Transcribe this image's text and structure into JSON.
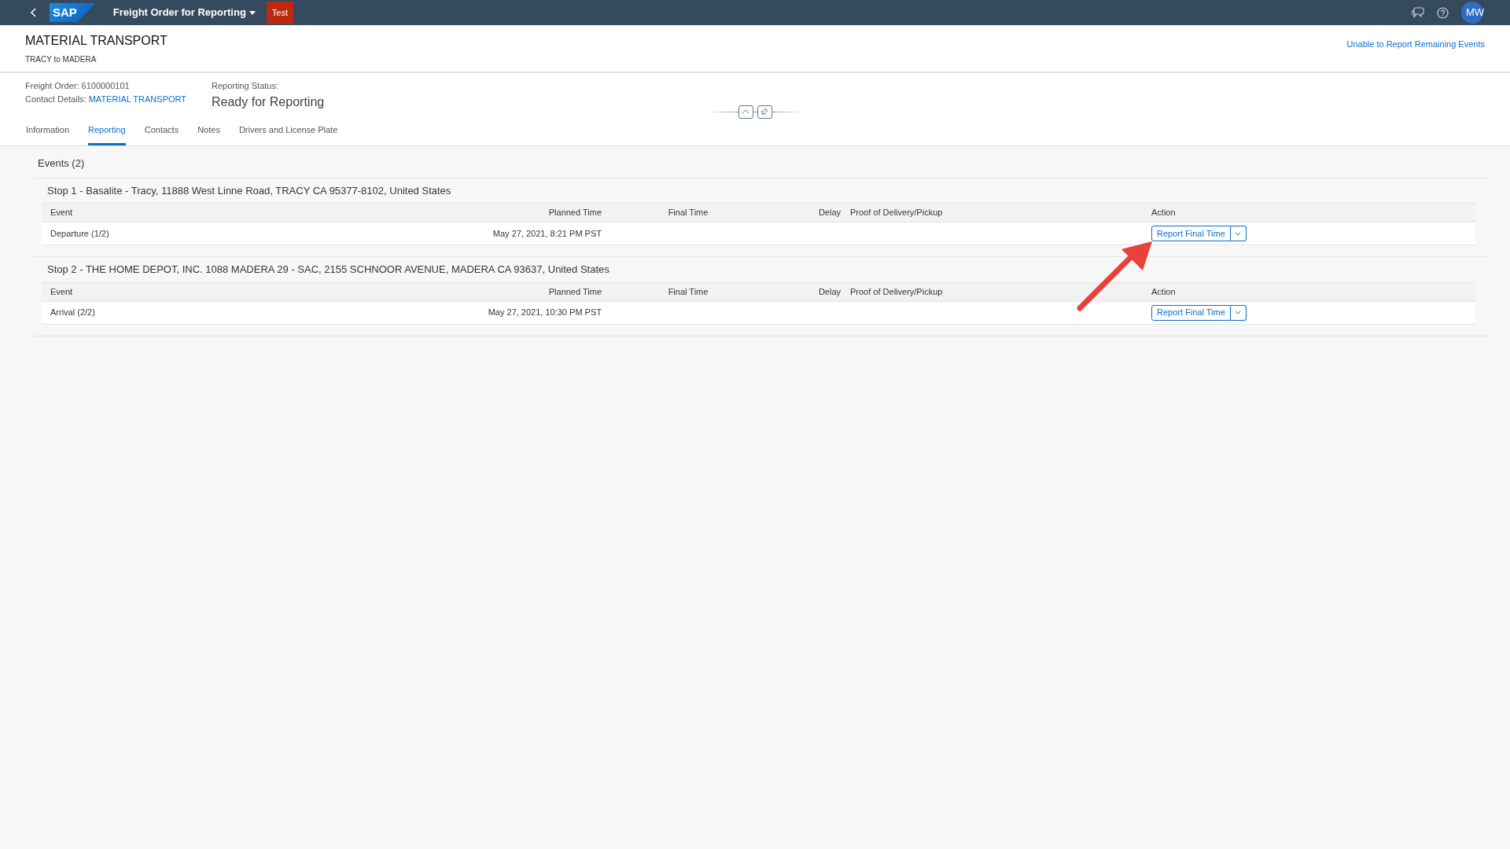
{
  "shell": {
    "logo": "SAP",
    "title": "Freight Order for Reporting",
    "badge": "Test",
    "avatar": "MW"
  },
  "header": {
    "title": "MATERIAL TRANSPORT",
    "subtitle": "TRACY to MADERA",
    "action_link": "Unable to Report Remaining Events",
    "fields": [
      {
        "label": "Freight Order:",
        "value": "6100000101",
        "kind": "text"
      },
      {
        "label": "Contact Details:",
        "value": "MATERIAL TRANSPORT",
        "kind": "link"
      }
    ],
    "status": {
      "label": "Reporting Status:",
      "value": "Ready for Reporting"
    }
  },
  "tabs": [
    {
      "label": "Information",
      "selected": false
    },
    {
      "label": "Reporting",
      "selected": true
    },
    {
      "label": "Contacts",
      "selected": false
    },
    {
      "label": "Notes",
      "selected": false
    },
    {
      "label": "Drivers and License Plate",
      "selected": false
    }
  ],
  "events": {
    "title": "Events (2)",
    "stops": [
      {
        "title": "Stop 1 - Basalite - Tracy, 11888 West Linne Road, TRACY CA 95377-8102, United States",
        "columns": [
          "Event",
          "Planned Time",
          "Final Time",
          "Delay",
          "Proof of Delivery/Pickup",
          "Action"
        ],
        "rows": [
          {
            "event": "Departure (1/2)",
            "planned_time": "May 27, 2021, 8:21 PM PST",
            "action": "Report Final Time"
          }
        ]
      },
      {
        "title": "Stop 2 - THE HOME DEPOT, INC. 1088 MADERA 29 - SAC, 2155 SCHNOOR AVENUE, MADERA CA 93637, United States",
        "columns": [
          "Event",
          "Planned Time",
          "Final Time",
          "Delay",
          "Proof of Delivery/Pickup",
          "Action"
        ],
        "rows": [
          {
            "event": "Arrival (2/2)",
            "planned_time": "May 27, 2021, 10:30 PM PST",
            "action": "Report Final Time"
          }
        ]
      }
    ]
  }
}
